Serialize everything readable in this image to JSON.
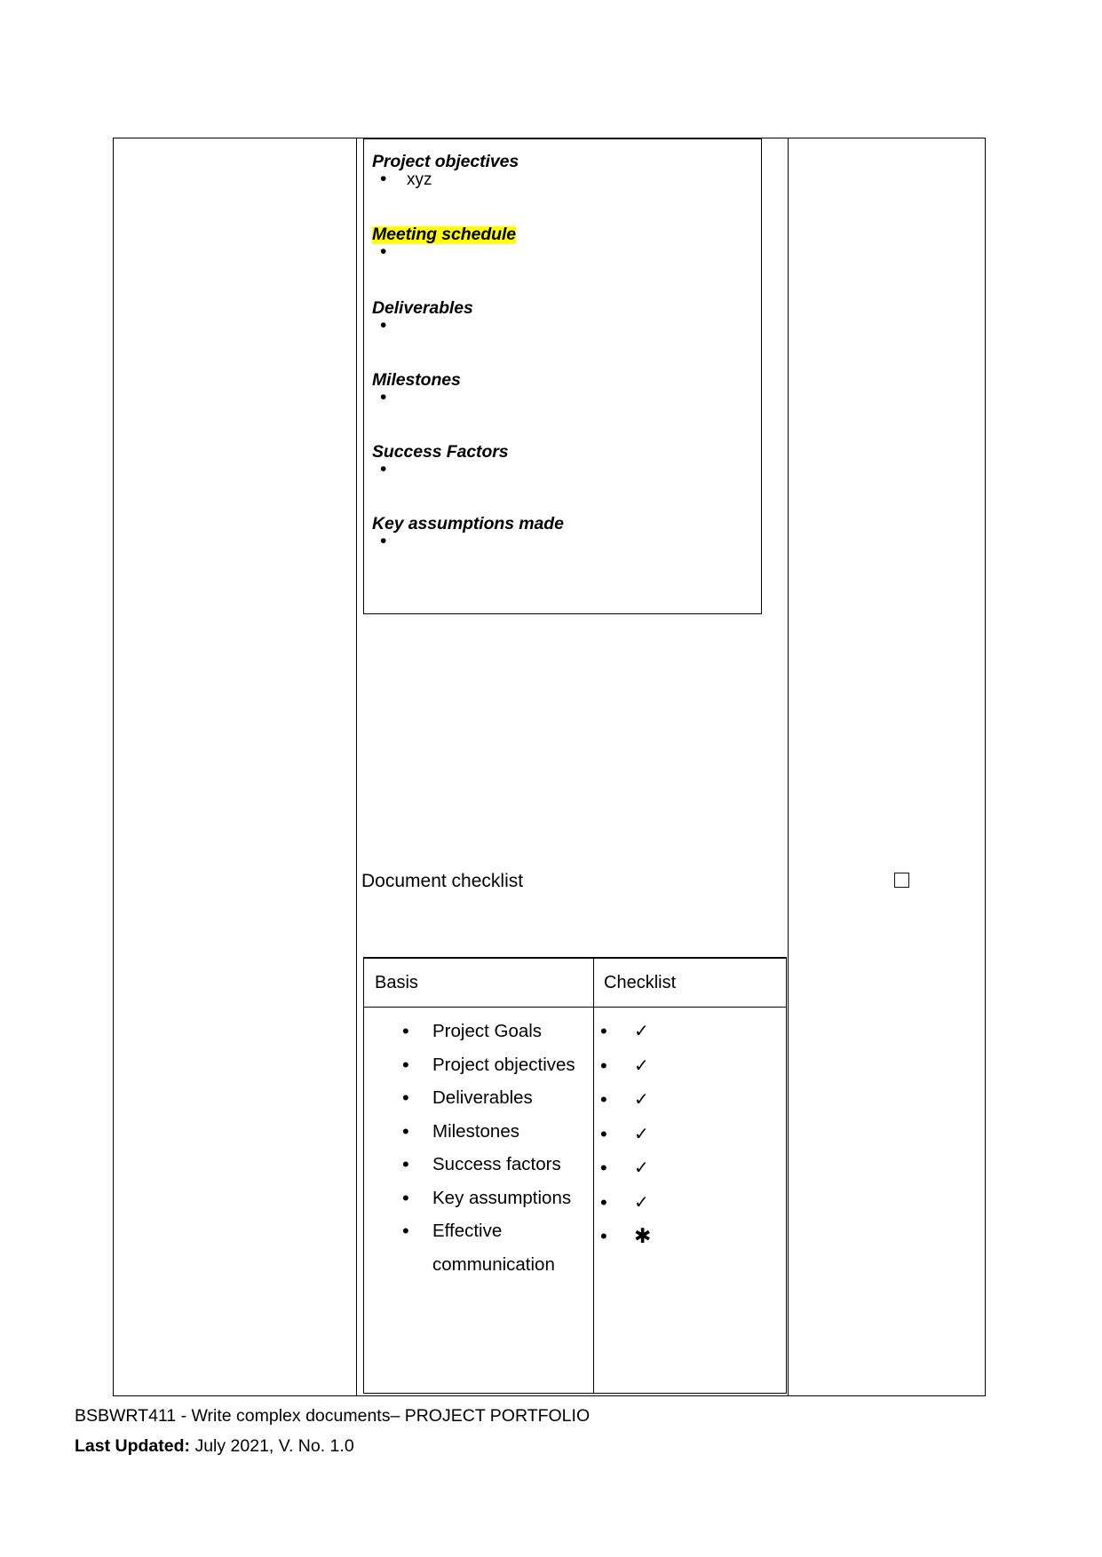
{
  "document": {
    "project_fields_box": {
      "sections": [
        {
          "heading": "Project objectives",
          "highlighted": false,
          "bullets": [
            "xyz"
          ]
        },
        {
          "heading": "Meeting schedule",
          "highlighted": true,
          "bullets": [
            ""
          ]
        },
        {
          "heading": "Deliverables",
          "highlighted": false,
          "bullets": [
            ""
          ]
        },
        {
          "heading": "Milestones",
          "highlighted": false,
          "bullets": [
            ""
          ]
        },
        {
          "heading": "Success Factors",
          "highlighted": false,
          "bullets": [
            ""
          ]
        },
        {
          "heading": "Key assumptions made",
          "highlighted": false,
          "bullets": [
            ""
          ]
        }
      ]
    },
    "document_checklist": {
      "label": "Document checklist",
      "checkbox_glyph": "☐",
      "checkbox_checked": false
    },
    "checklist_table": {
      "headers": [
        "Basis",
        "Checklist"
      ],
      "rows": [
        {
          "basis": "Project Goals",
          "mark": "✓"
        },
        {
          "basis": "Project objectives",
          "mark": "✓"
        },
        {
          "basis": "Deliverables",
          "mark": "✓"
        },
        {
          "basis": "Milestones",
          "mark": "✓"
        },
        {
          "basis": "Success factors",
          "mark": "✓"
        },
        {
          "basis": "Key assumptions",
          "mark": "✓"
        },
        {
          "basis": "Effective communication",
          "basis_line_1": "Effective",
          "basis_line_2": "communication",
          "mark": "✱"
        }
      ]
    },
    "footer": {
      "course_line": "BSBWRT411 - Write complex documents– PROJECT PORTFOLIO",
      "last_updated_label": "Last Updated:",
      "last_updated_value": "July 2021, V. No. 1.0"
    }
  },
  "colors": {
    "highlight": "#FFFF00",
    "border": "#000000",
    "text": "#000000",
    "page_background": "#FFFFFF"
  }
}
